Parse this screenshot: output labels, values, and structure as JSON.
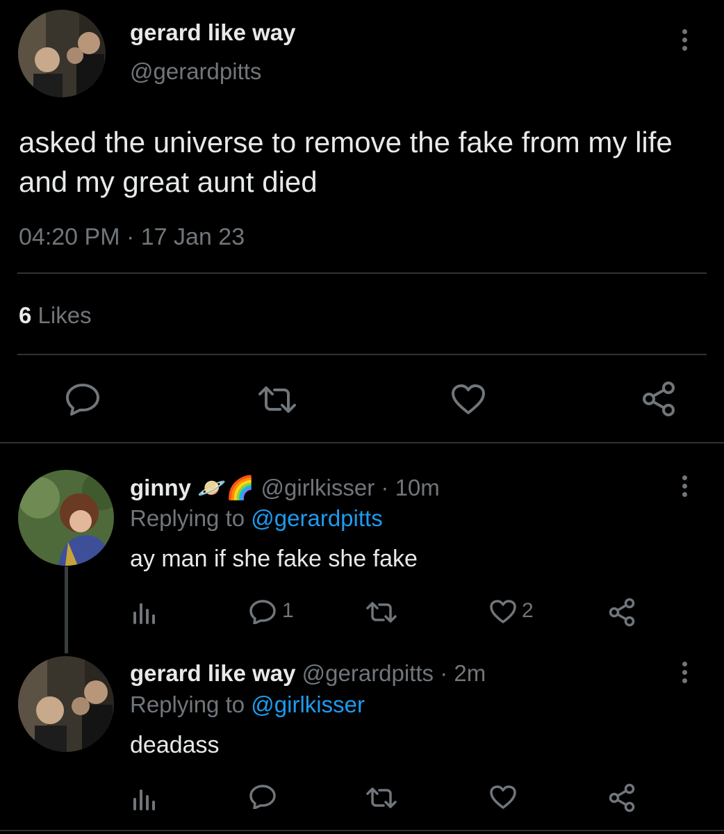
{
  "tweet": {
    "author_name": "gerard like way",
    "author_handle": "@gerardpitts",
    "text": "asked the universe to remove the fake from my life and my great aunt died",
    "time": "04:20 PM",
    "date_sep": "·",
    "date": "17 Jan 23",
    "likes_count": "6",
    "likes_label": "Likes"
  },
  "replies": [
    {
      "author_name": "ginny",
      "name_emojis": "🪐🌈",
      "author_handle": "@girlkisser",
      "dot": "·",
      "time": "10m",
      "replying_label": "Replying to",
      "replying_handle": "@gerardpitts",
      "text": "ay man if she fake she fake",
      "reply_count": "1",
      "like_count": "2"
    },
    {
      "author_name": "gerard like way",
      "author_handle": "@gerardpitts",
      "dot": "·",
      "time": "2m",
      "replying_label": "Replying to",
      "replying_handle": "@girlkisser",
      "text": "deadass"
    }
  ],
  "icons": {
    "more": "more-icon",
    "reply": "reply-icon",
    "retweet": "retweet-icon",
    "like": "heart-icon",
    "share": "share-icon",
    "analytics": "analytics-icon"
  },
  "colors": {
    "background": "#000000",
    "text": "#e7e9ea",
    "muted": "#71767b",
    "link": "#1d9bf0",
    "divider": "#2f3336"
  }
}
